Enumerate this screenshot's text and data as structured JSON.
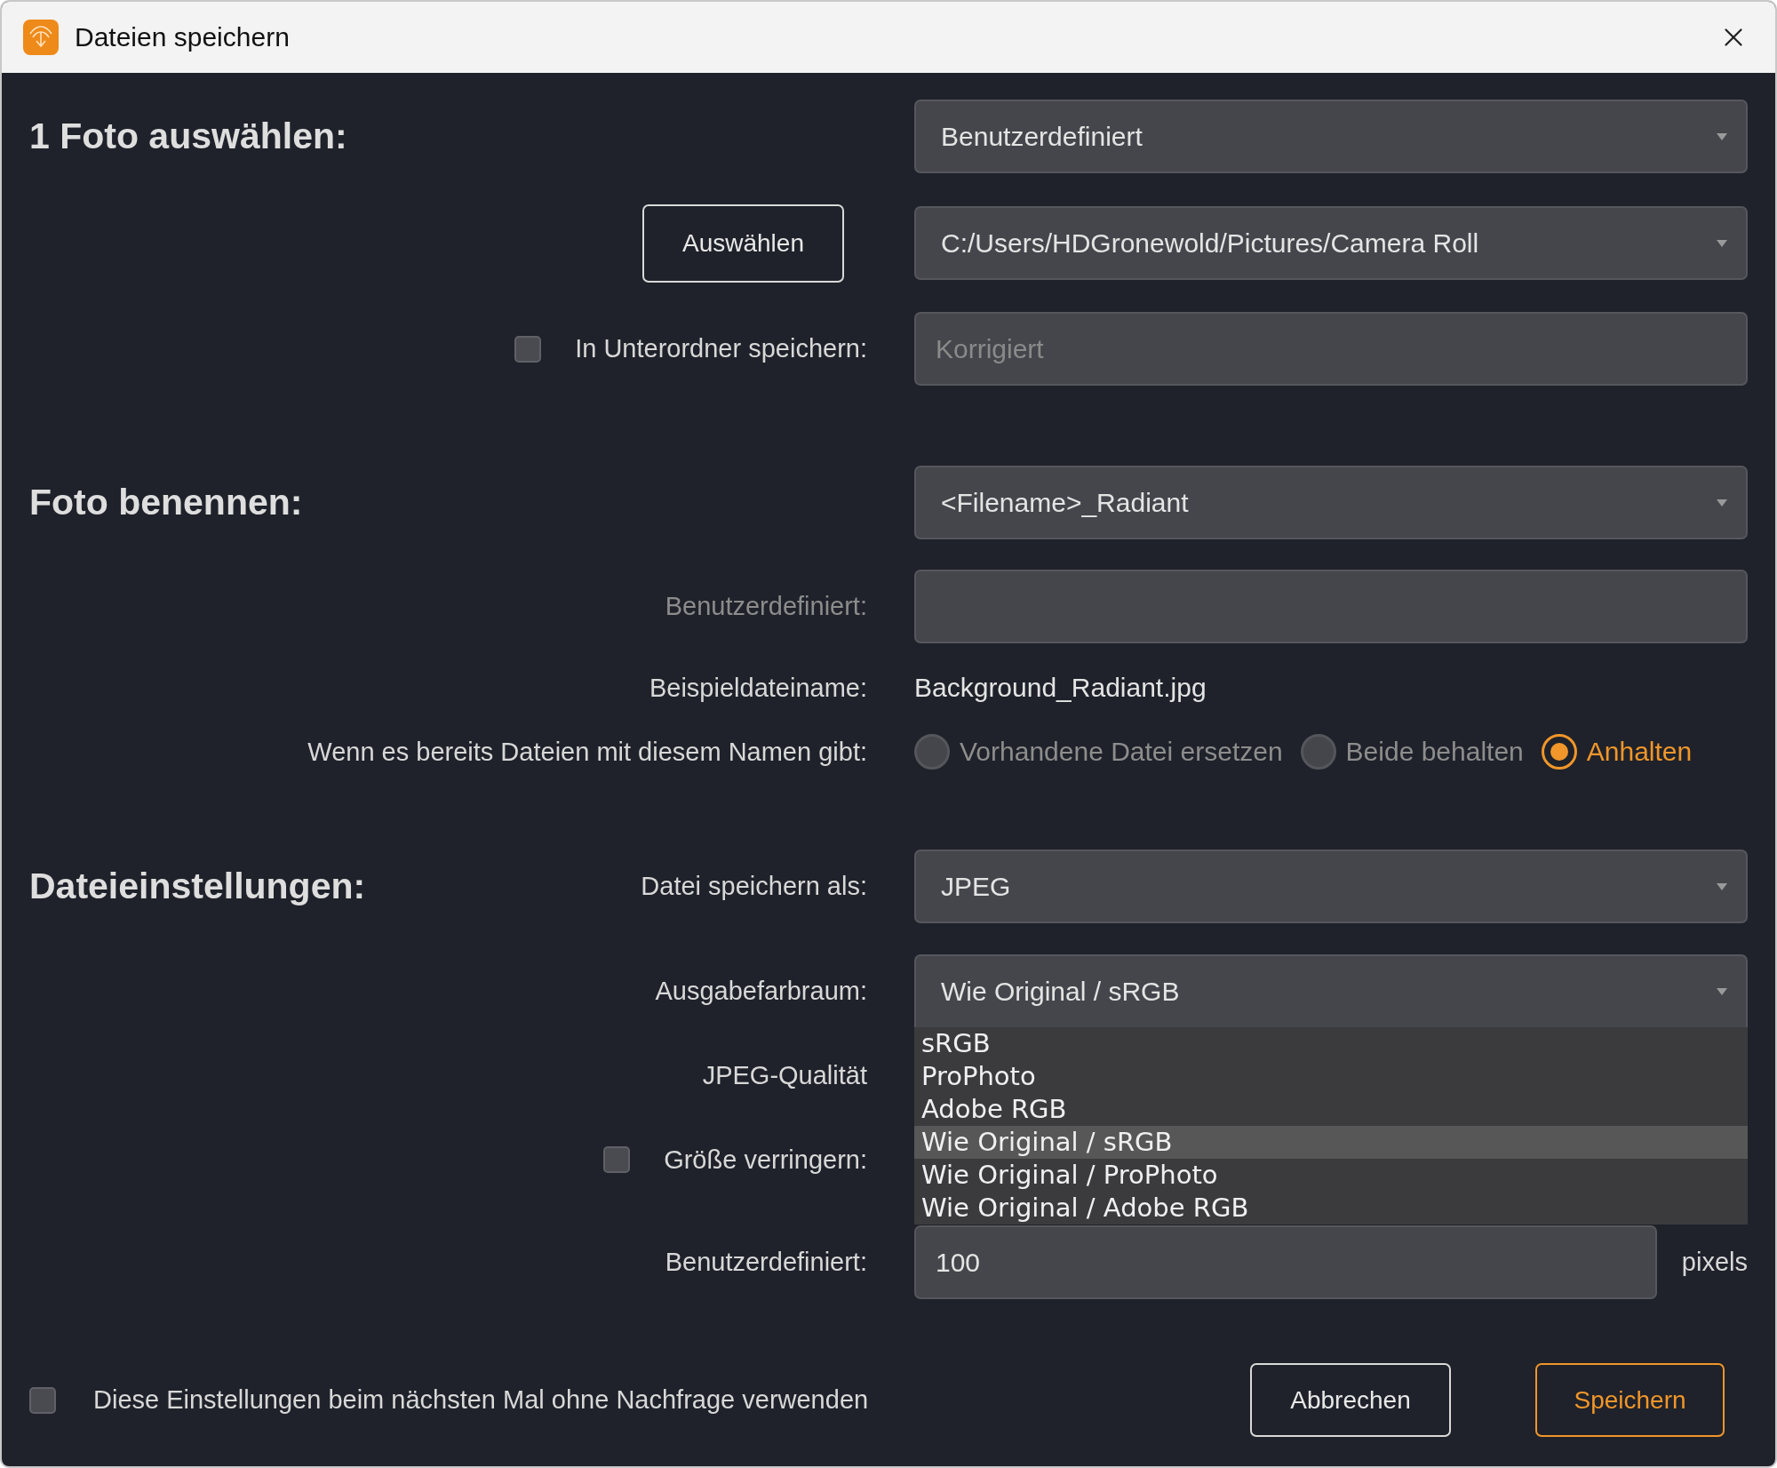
{
  "window": {
    "title": "Dateien speichern"
  },
  "select_photo": {
    "heading": "1 Foto auswählen:",
    "preset": "Benutzerdefiniert",
    "choose_button": "Auswählen",
    "folder": "C:/Users/HDGronewold/Pictures/Camera Roll",
    "subfolder": {
      "label": "In Unterordner speichern:",
      "checked": false,
      "value": "Korrigiert",
      "disabled": true
    }
  },
  "naming": {
    "heading": "Foto benennen:",
    "template": "<Filename>_Radiant",
    "custom": {
      "label": "Benutzerdefiniert:",
      "disabled": true
    },
    "example_label": "Beispieldateiname:",
    "example_value": "Background_Radiant.jpg",
    "conflict_label": "Wenn es bereits Dateien mit diesem Namen gibt:",
    "conflict_options": [
      {
        "label": "Vorhandene Datei ersetzen",
        "selected": false
      },
      {
        "label": "Beide behalten",
        "selected": false
      },
      {
        "label": "Anhalten",
        "selected": true
      }
    ]
  },
  "file_settings": {
    "heading": "Dateieinstellungen:",
    "format_label": "Datei speichern als:",
    "format": "JPEG",
    "color_space_label": "Ausgabefarbraum:",
    "color_space": "Wie Original / sRGB",
    "color_space_menu": {
      "expanded": true,
      "options": [
        {
          "label": "sRGB",
          "selected": false
        },
        {
          "label": "ProPhoto",
          "selected": false
        },
        {
          "label": "Adobe RGB",
          "selected": false
        },
        {
          "label": "Wie Original / sRGB",
          "selected": true
        },
        {
          "label": "Wie Original / ProPhoto",
          "selected": false
        },
        {
          "label": "Wie Original / Adobe RGB",
          "selected": false
        }
      ]
    },
    "quality_label": "JPEG-Qualität",
    "resize": {
      "label": "Größe verringern:",
      "checked": false
    },
    "custom_label": "Benutzerdefiniert:",
    "custom_value": "100",
    "unit": "pixels"
  },
  "footer": {
    "remember": {
      "label": "Diese Einstellungen beim nächsten Mal ohne Nachfrage verwenden",
      "checked": false
    },
    "buttons": [
      {
        "label": "Abbrechen",
        "kind": "secondary"
      },
      {
        "label": "Speichern",
        "kind": "primary"
      }
    ]
  }
}
